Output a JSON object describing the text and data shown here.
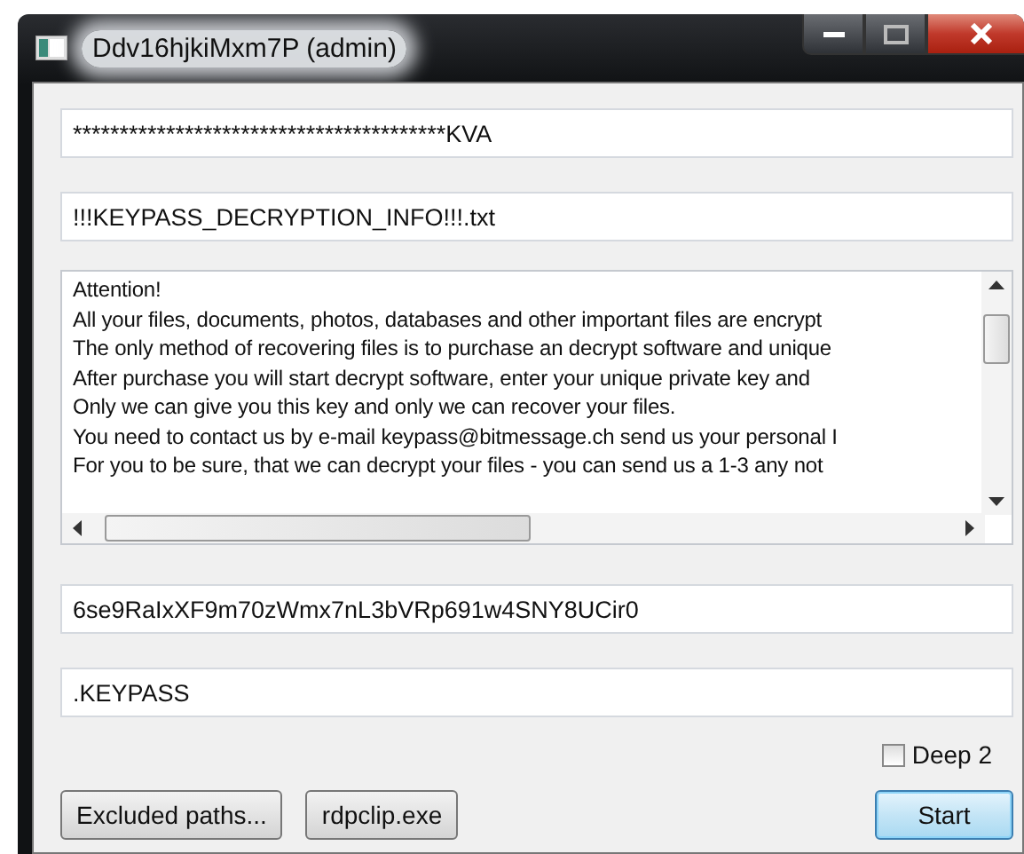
{
  "window": {
    "title": "Ddv16hjkiMxm7P (admin)"
  },
  "fields": [
    {
      "value": "****************************************KVA"
    },
    {
      "value": "!!!KEYPASS_DECRYPTION_INFO!!!.txt"
    }
  ],
  "message": {
    "lines": [
      "Attention!",
      "All your files, documents, photos, databases and other important files are encrypt",
      "The only method of recovering files is to purchase an decrypt software and unique",
      "After purchase you will start decrypt software, enter your unique private key and",
      "Only we can give you this key and only we can recover your files.",
      "You need to contact us by e-mail keypass@bitmessage.ch send us your personal I",
      "For you to be sure, that we can decrypt your files - you can send us a 1-3 any not"
    ]
  },
  "key_field": {
    "value": "6se9RaIxXF9m70zWmx7nL3bVRp691w4SNY8UCir0"
  },
  "extension_field": {
    "value": ".KEYPASS"
  },
  "deep": {
    "label": "Deep 2",
    "checked": false
  },
  "buttons": [
    {
      "label": "Excluded paths...",
      "default": false
    },
    {
      "label": "rdpclip.exe",
      "default": false
    },
    {
      "label": "Start",
      "default": true
    }
  ]
}
